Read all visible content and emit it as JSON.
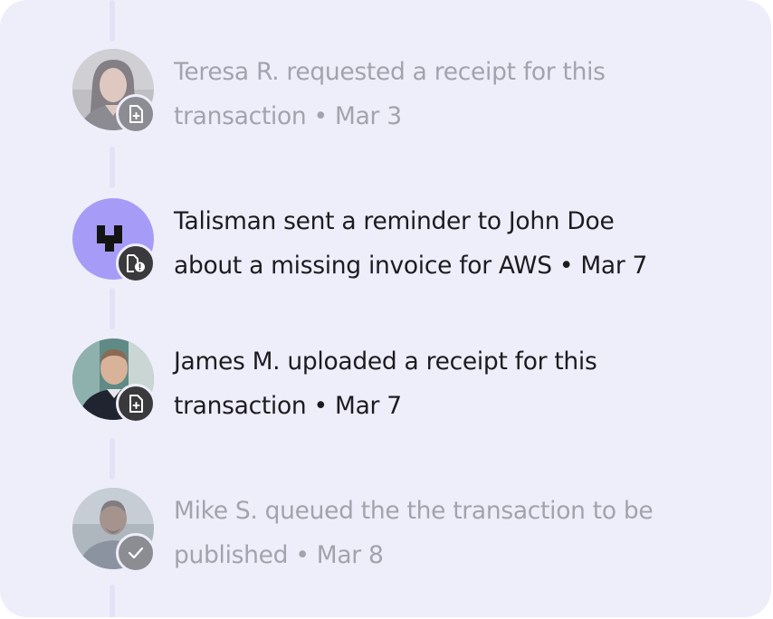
{
  "activity": {
    "items": [
      {
        "message_line1": "Teresa R. requested a receipt for this",
        "message_line2": "transaction",
        "date": "Mar 3",
        "badge_icon": "file-plus-icon",
        "faded": true
      },
      {
        "message_line1": "Talisman sent a reminder to John Doe",
        "message_line2": "about a missing invoice for AWS",
        "date": "Mar 7",
        "badge_icon": "file-alert-icon",
        "faded": false
      },
      {
        "message_line1": "James M. uploaded a receipt for this",
        "message_line2": "transaction",
        "date": "Mar 7",
        "badge_icon": "file-plus-icon",
        "faded": false
      },
      {
        "message_line1": "Mike S. queued the the transaction to be",
        "message_line2": "published",
        "date": "Mar 8",
        "badge_icon": "check-icon",
        "faded": true
      }
    ],
    "separator": "•"
  },
  "colors": {
    "card_background": "#eeeefb",
    "talisman_avatar": "#a69cf7",
    "badge_dark": "#3a3a3d",
    "text_primary": "#1c1c20",
    "text_muted": "#a3a3ab"
  }
}
